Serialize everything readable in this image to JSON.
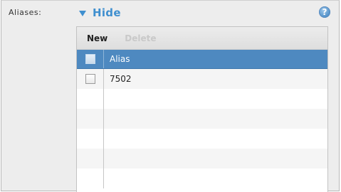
{
  "field": {
    "label": "Aliases:"
  },
  "toggle": {
    "label": "Hide"
  },
  "help": {
    "glyph": "?"
  },
  "toolbar": {
    "new_label": "New",
    "delete_label": "Delete"
  },
  "table": {
    "column_header": "Alias",
    "rows": [
      {
        "alias": "7502",
        "checked": false
      },
      {
        "alias": ""
      },
      {
        "alias": ""
      },
      {
        "alias": ""
      },
      {
        "alias": ""
      },
      {
        "alias": ""
      }
    ]
  },
  "colors": {
    "accent": "#3f8fcf",
    "header_bg": "#4e89c0",
    "panel_bg": "#ededed"
  }
}
